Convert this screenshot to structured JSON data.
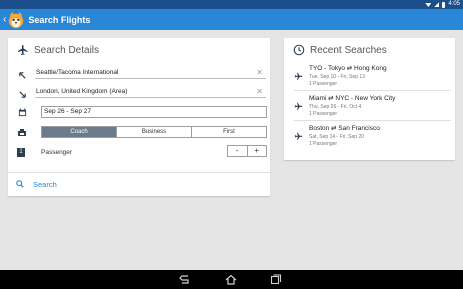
{
  "status_bar": {
    "time": "4:05"
  },
  "app_bar": {
    "back_icon": "chevron-left",
    "title": "Search Flights"
  },
  "search_details": {
    "title": "Search Details",
    "origin": {
      "value": "Seattle/Tacoma International"
    },
    "destination": {
      "value": "London, United Kingdom (Area)"
    },
    "dates": {
      "value": "Sep 26 - Sep 27"
    },
    "cabin_classes": [
      "Coach",
      "Business",
      "First"
    ],
    "selected_cabin": "Coach",
    "passengers": {
      "count": "1",
      "label": "Passenger",
      "minus": "-",
      "plus": "+"
    },
    "search_button": "Search"
  },
  "recent_searches": {
    "title": "Recent Searches",
    "items": [
      {
        "route": "TYO - Tokyo ⇄ Hong Kong",
        "dates": "Tue, Sep 10 - Fri, Sep 13",
        "passengers": "1 Passenger"
      },
      {
        "route": "Miami ⇄ NYC - New York City",
        "dates": "Thu, Sep 26 - Fri, Oct 4",
        "passengers": "1 Passenger"
      },
      {
        "route": "Boston ⇄ San Francisco",
        "dates": "Sat, Sep 14 - Fri, Sep 20",
        "passengers": "1 Passenger"
      }
    ]
  },
  "colors": {
    "app_bar": "#2a86d6",
    "status_bar": "#1b4f8c",
    "accent": "#2a86d6",
    "segment_selected": "#6b7b8c"
  }
}
